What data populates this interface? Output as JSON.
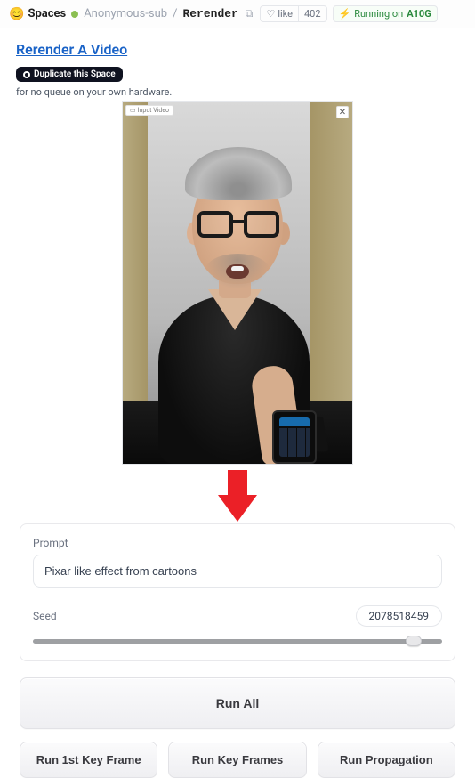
{
  "header": {
    "spaces_label": "Spaces",
    "owner": "Anonymous-sub",
    "space_name": "Rerender",
    "like_label": "like",
    "like_count": "402",
    "running_label": "Running on",
    "gpu": "A10G"
  },
  "page": {
    "title": "Rerender A Video",
    "duplicate_label": "Duplicate this Space",
    "queue_note": "for no queue on your own hardware."
  },
  "video": {
    "tag": "Input Video"
  },
  "form": {
    "prompt_label": "Prompt",
    "prompt_value": "Pixar like effect from cartoons",
    "seed_label": "Seed",
    "seed_value": "2078518459",
    "slider_position_pct": 93
  },
  "buttons": {
    "run_all": "Run All",
    "run_first": "Run 1st Key Frame",
    "run_keys": "Run Key Frames",
    "run_prop": "Run Propagation"
  }
}
